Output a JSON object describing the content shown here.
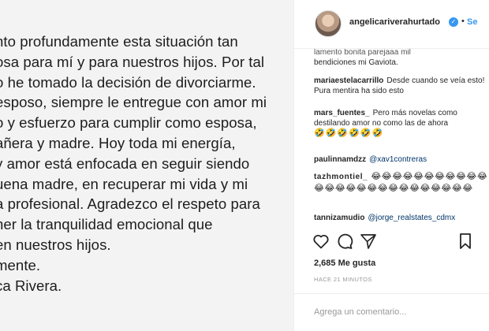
{
  "post_image": {
    "lines": [
      "nto profundamente esta situación tan",
      "osa para mí y para nuestros hijos. Por tal",
      "o he tomado la decisión de divorciarme.",
      "esposo, siempre le entregue con amor mi",
      "o y esfuerzo para cumplir como esposa,",
      "añera y madre. Hoy toda mi energía,",
      " y amor está enfocada en seguir siendo",
      "uena madre, en recuperar mi vida y mi",
      "a profesional. Agradezco el respeto para",
      "ner la tranquilidad emocional que",
      "en nuestros hijos.",
      "mente.",
      "ca Rivera."
    ]
  },
  "header": {
    "username": "angelicariverahurtado",
    "separator": "•",
    "follow_label": "Se"
  },
  "comments": [
    {
      "user": "",
      "text": "lamento bonita parejaaa mil",
      "partial": true
    },
    {
      "user": "",
      "text": "bendiciones mi Gaviota."
    },
    {
      "user": "mariaestelacarrillo",
      "text": "Desde cuando se veía esto! Pura mentira ha sido esto"
    },
    {
      "user": "mars_fuentes_",
      "text": "Pero más novelas como destilando amor no como las de ahora"
    },
    {
      "user": "",
      "text": "🤣🤣🤣🤣🤣🤣"
    },
    {
      "user": "paulinnamdzz",
      "mention": "@xav1contreras"
    },
    {
      "user": "tazhmontiel_",
      "text": "😂😂😂😂😂😂😂😂😂😂😂😂😂😂😂😂😂😂😂😂😂😂😂😂😂😂"
    },
    {
      "user": "tannizamudio",
      "mention": "@jorge_realstates_cdmx"
    }
  ],
  "actions": {
    "like_icon": "heart-icon",
    "comment_icon": "comment-icon",
    "share_icon": "share-icon",
    "save_icon": "bookmark-icon"
  },
  "likes": "2,685 Me gusta",
  "timestamp": "HACE 21 MINUTOS",
  "add_comment": {
    "placeholder": "Agrega un comentario..."
  },
  "colors": {
    "link": "#3897f0",
    "mention": "#003569",
    "muted": "#999999",
    "text": "#262626"
  }
}
